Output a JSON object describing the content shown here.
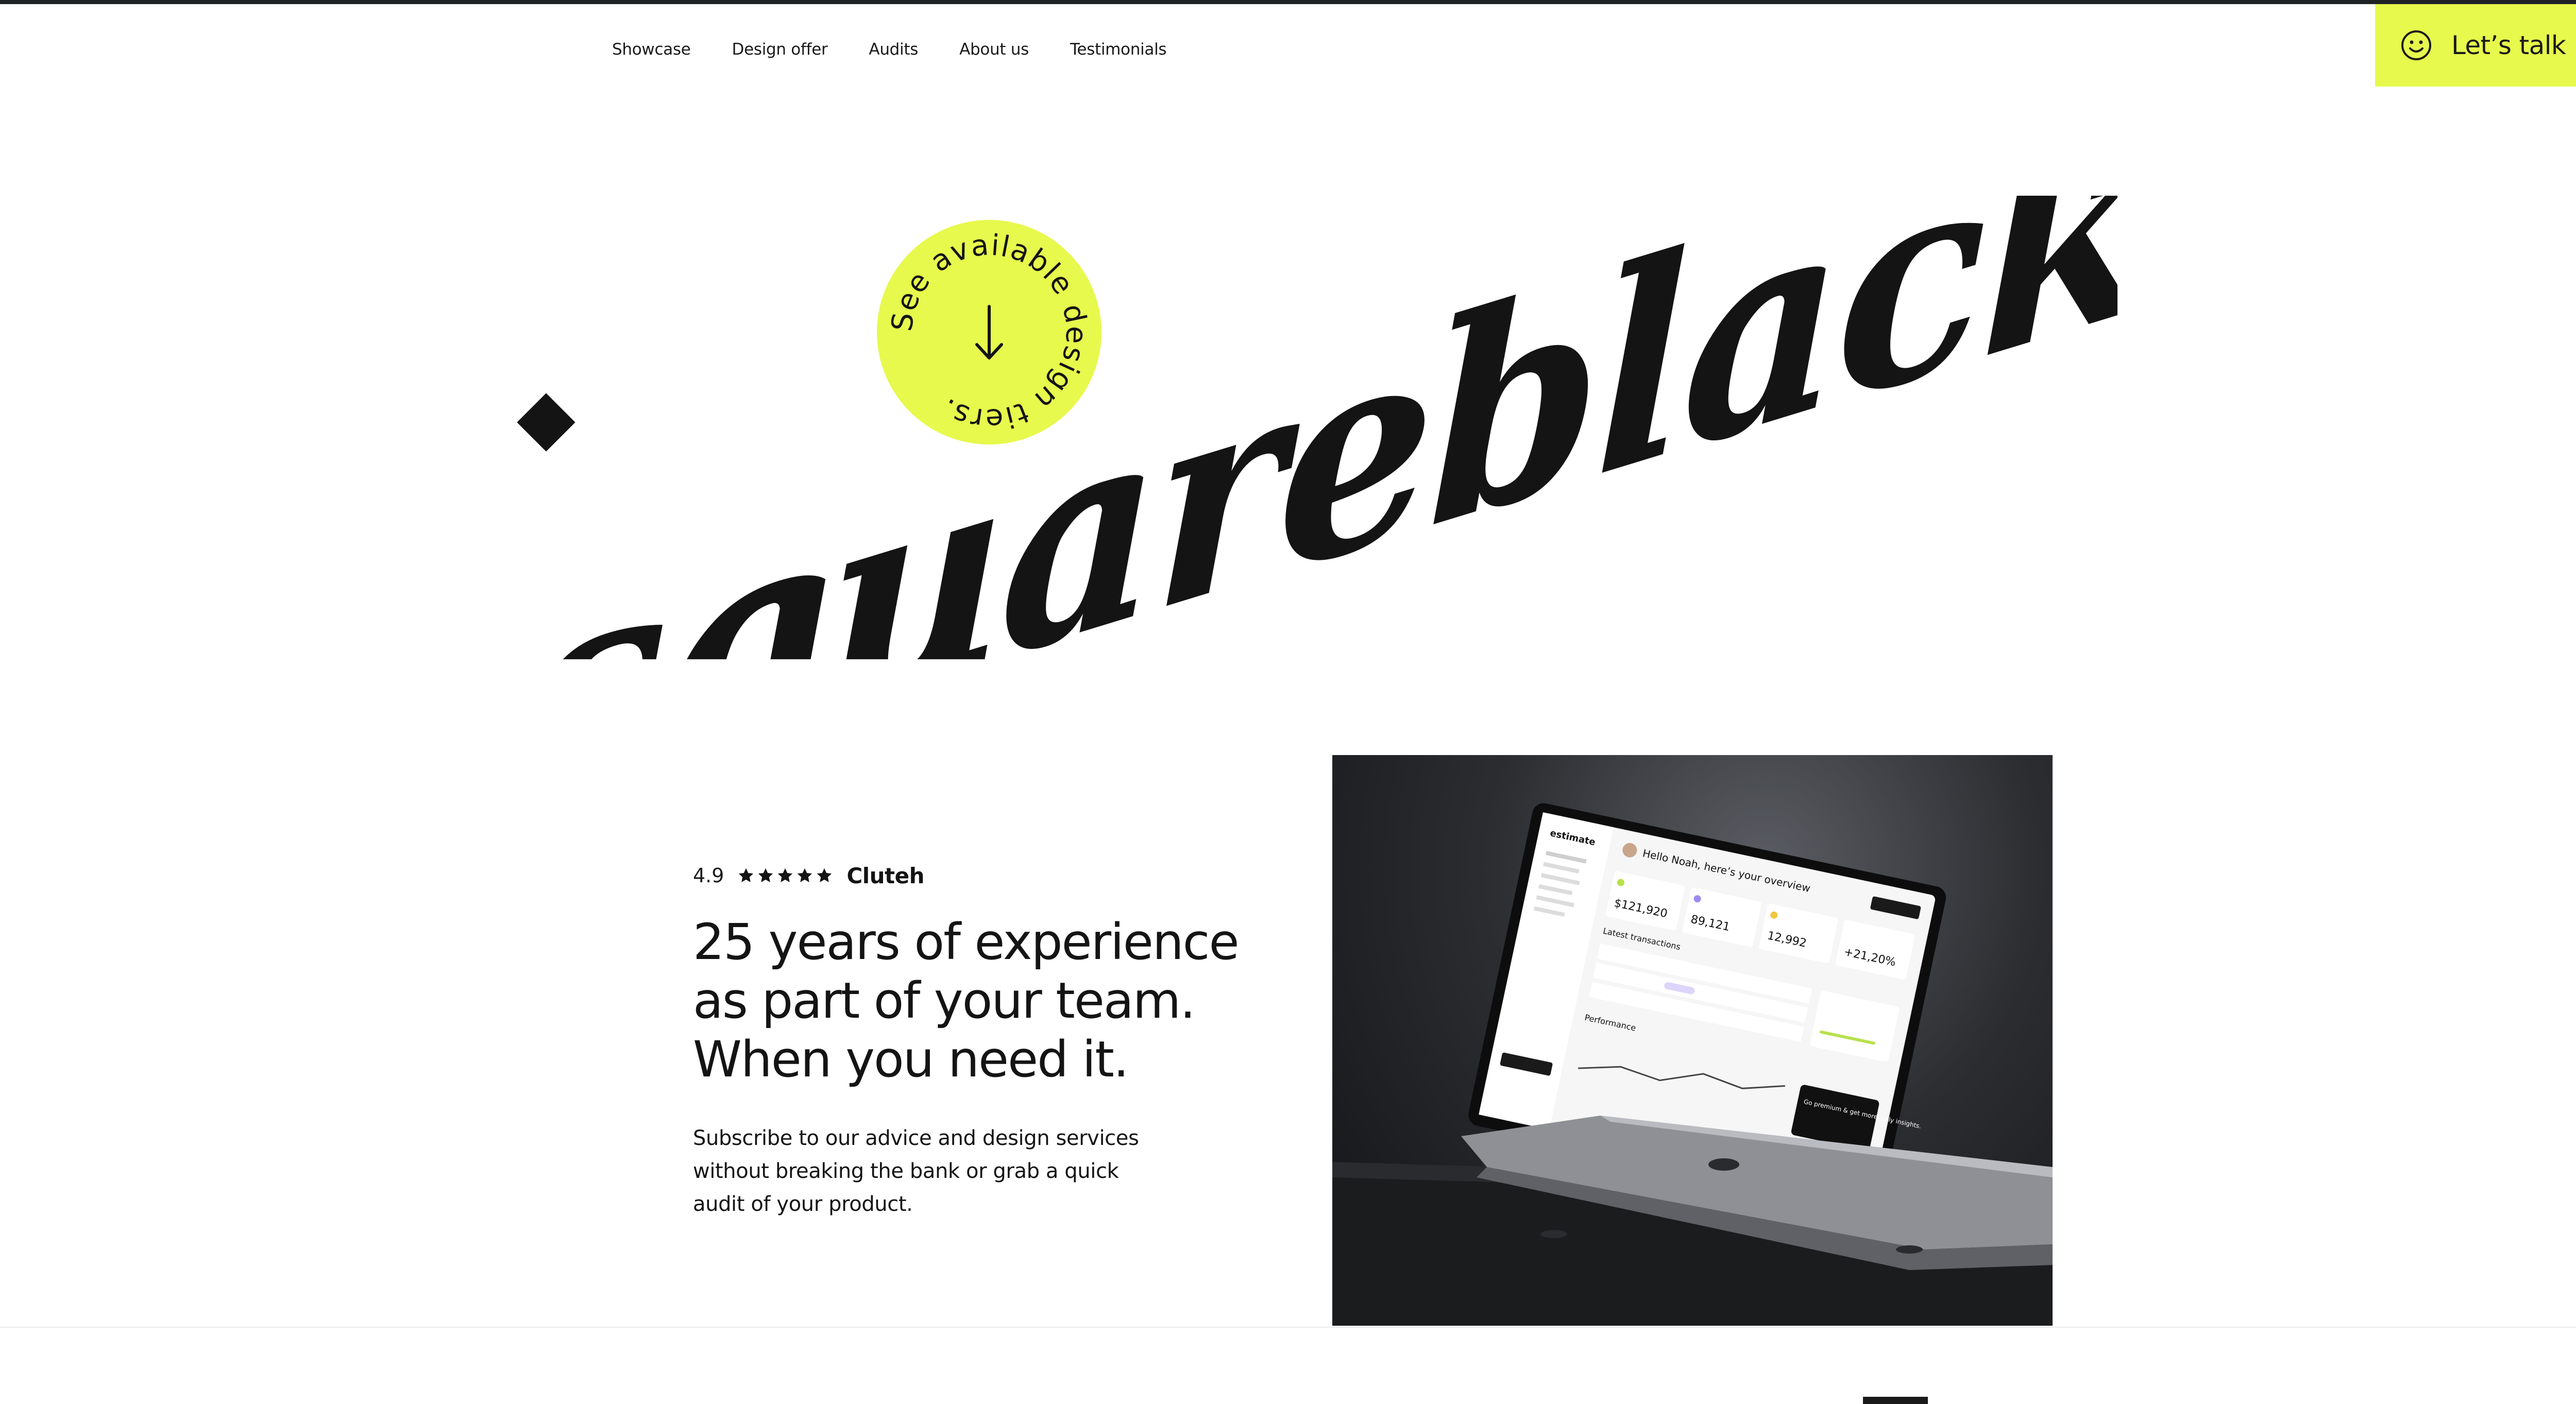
{
  "nav": {
    "items": [
      {
        "label": "Showcase"
      },
      {
        "label": "Design offer"
      },
      {
        "label": "Audits"
      },
      {
        "label": "About us"
      },
      {
        "label": "Testimonials"
      }
    ]
  },
  "cta": {
    "label": "Let’s talk",
    "icon": "smile-icon",
    "arrow_icon": "arrow-right-icon"
  },
  "logo": {
    "text": "squareblack"
  },
  "badge": {
    "text": "See available design tiers.",
    "icon": "arrow-down-icon"
  },
  "rating": {
    "score": "4.9",
    "stars": 5,
    "platform": "Cluteh"
  },
  "headline": [
    "25 years of experience",
    "as part of your team.",
    "When you need it."
  ],
  "subtext": "Subscribe to our advice and design services without breaking the bank or grab a quick audit of your product.",
  "laptop": {
    "brand": "estimate",
    "greeting": "Hello Noah, here’s your overview",
    "stats": [
      "$121,920",
      "89,121",
      "12,992",
      "+21,20%"
    ],
    "section_transactions": "Latest transactions",
    "section_performance": "Performance",
    "promo": "Go premium & get more daily insights."
  },
  "colors": {
    "accent": "#e7f94c",
    "text": "#141414",
    "background": "#ffffff"
  }
}
